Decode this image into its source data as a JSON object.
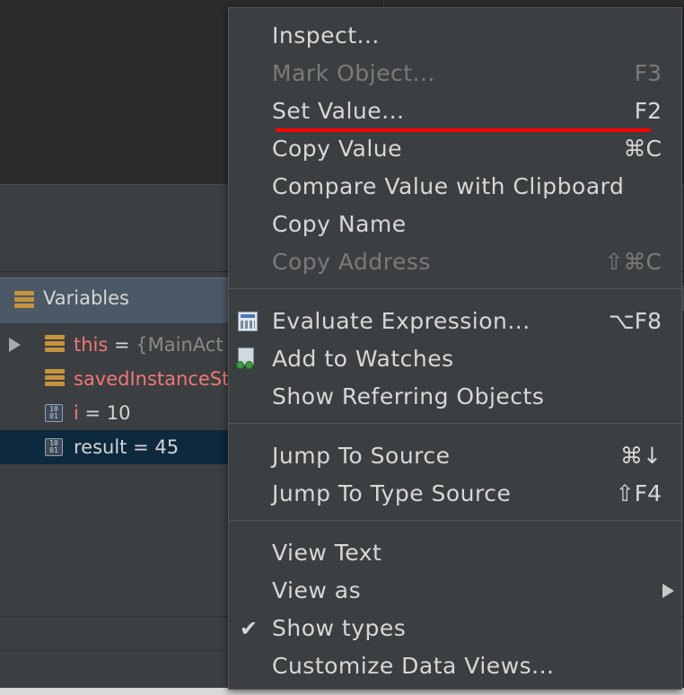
{
  "variables_panel": {
    "title": "Variables",
    "rows": [
      {
        "name": "this",
        "eq": " = ",
        "value": "{MainAct",
        "expandable": true
      },
      {
        "name": "savedInstanceSta",
        "eq": "",
        "value": ""
      },
      {
        "name": "i",
        "eq": " = ",
        "value": "10"
      },
      {
        "name": "result",
        "eq": " = ",
        "value": "45",
        "selected": true
      }
    ]
  },
  "context_menu": {
    "items": [
      {
        "label": "Inspect...",
        "shortcut": "",
        "disabled": false
      },
      {
        "label": "Mark Object...",
        "shortcut": "F3",
        "disabled": true
      },
      {
        "label": "Set Value...",
        "shortcut": "F2",
        "disabled": false,
        "highlighted_underline": true
      },
      {
        "label": "Copy Value",
        "shortcut": "⌘C",
        "disabled": false
      },
      {
        "label": "Compare Value with Clipboard",
        "shortcut": "",
        "disabled": false
      },
      {
        "label": "Copy Name",
        "shortcut": "",
        "disabled": false
      },
      {
        "label": "Copy Address",
        "shortcut": "⇧⌘C",
        "disabled": true
      },
      {
        "label": "Evaluate Expression...",
        "shortcut": "⌥F8",
        "disabled": false,
        "icon": "calculator-icon"
      },
      {
        "label": "Add to Watches",
        "shortcut": "",
        "disabled": false,
        "icon": "watch-glasses-icon"
      },
      {
        "label": "Show Referring Objects",
        "shortcut": "",
        "disabled": false
      },
      {
        "label": "Jump To Source",
        "shortcut": "⌘↓",
        "disabled": false
      },
      {
        "label": "Jump To Type Source",
        "shortcut": "⇧F4",
        "disabled": false
      },
      {
        "label": "View Text",
        "shortcut": "",
        "disabled": false
      },
      {
        "label": "View as",
        "shortcut": "",
        "disabled": false,
        "submenu": true
      },
      {
        "label": "Show types",
        "shortcut": "",
        "disabled": false,
        "checked": true
      },
      {
        "label": "Customize Data Views...",
        "shortcut": "",
        "disabled": false
      }
    ]
  },
  "colors": {
    "menu_bg": "#3c3f41",
    "annotation_underline": "#ff0000",
    "variable_name": "#ef7777",
    "selection_bg": "#0d293e"
  }
}
